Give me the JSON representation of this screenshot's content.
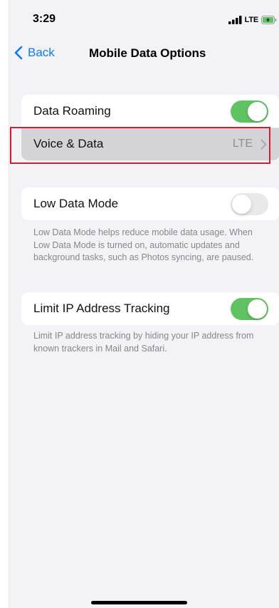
{
  "status_bar": {
    "time": "3:29",
    "network": "LTE",
    "signal_icon": "cellular-signal-icon",
    "battery_icon": "battery-charging-icon"
  },
  "nav": {
    "back_label": "Back",
    "title": "Mobile Data Options"
  },
  "group1": {
    "data_roaming": {
      "label": "Data Roaming",
      "enabled": true
    },
    "voice_data": {
      "label": "Voice & Data",
      "value": "LTE"
    }
  },
  "low_data": {
    "label": "Low Data Mode",
    "enabled": false,
    "footer": "Low Data Mode helps reduce mobile data usage. When Low Data Mode is turned on, automatic updates and background tasks, such as Photos syncing, are paused."
  },
  "limit_ip": {
    "label": "Limit IP Address Tracking",
    "enabled": true,
    "footer": "Limit IP address tracking by hiding your IP address from known trackers in Mail and Safari."
  },
  "colors": {
    "accent": "#0a7aff",
    "toggle_on": "#5fc361",
    "highlight": "#e0182d"
  }
}
